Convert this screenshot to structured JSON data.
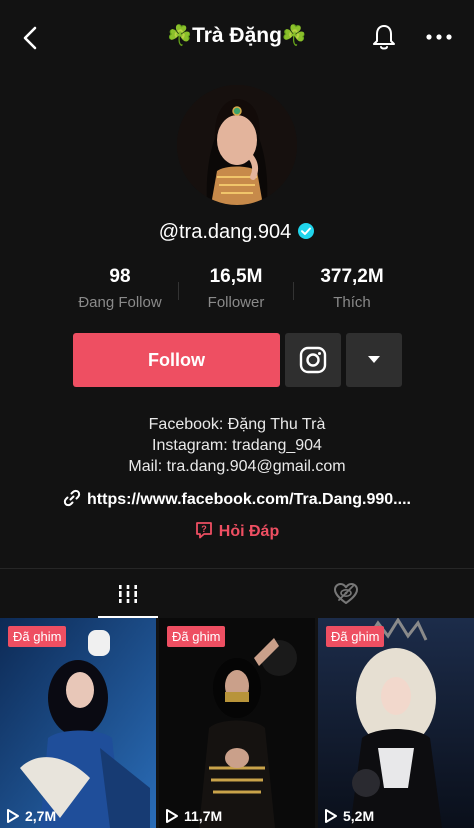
{
  "header": {
    "title": "Trà Đặng",
    "title_emoji": "☘️",
    "back_icon": "chevron-left-icon",
    "bell_icon": "bell-icon",
    "more_icon": "more-horizontal-icon"
  },
  "profile": {
    "username": "@tra.dang.904",
    "verified": true
  },
  "stats": [
    {
      "value": "98",
      "label": "Đang Follow"
    },
    {
      "value": "16,5M",
      "label": "Follower"
    },
    {
      "value": "377,2M",
      "label": "Thích"
    }
  ],
  "actions": {
    "follow_label": "Follow",
    "instagram_icon": "instagram-icon",
    "dropdown_icon": "caret-down-icon"
  },
  "bio": {
    "line1": "Facebook: Đặng Thu Trà",
    "line2": "Instagram: tradang_904",
    "line3": "Mail: tra.dang.904@gmail.com",
    "link": "https://www.facebook.com/Tra.Dang.990....",
    "qa_label": "Hỏi Đáp"
  },
  "tabs": {
    "videos_icon": "grid-bars-icon",
    "liked_icon": "hidden-heart-icon"
  },
  "videos": [
    {
      "pin_label": "Đã ghim",
      "views": "2,7M"
    },
    {
      "pin_label": "Đã ghim",
      "views": "11,7M"
    },
    {
      "pin_label": "Đã ghim",
      "views": "5,2M"
    }
  ],
  "colors": {
    "background": "#121212",
    "accent": "#ee4f62",
    "secondary_button": "#2f2f2f",
    "muted_text": "#8a8a8a",
    "verified": "#20d5ec"
  }
}
